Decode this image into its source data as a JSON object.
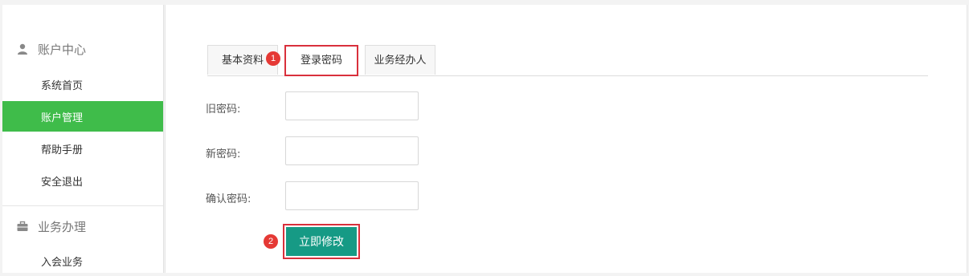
{
  "sidebar": {
    "section1": {
      "icon": "user-icon",
      "title": "账户中心"
    },
    "items1": [
      {
        "label": "系统首页"
      },
      {
        "label": "账户管理",
        "active": true
      },
      {
        "label": "帮助手册"
      },
      {
        "label": "安全退出"
      }
    ],
    "section2": {
      "icon": "briefcase-icon",
      "title": "业务办理"
    },
    "items2": [
      {
        "label": "入会业务"
      }
    ]
  },
  "tabs": [
    {
      "label": "基本资料"
    },
    {
      "label": "登录密码",
      "active": true
    },
    {
      "label": "业务经办人"
    }
  ],
  "badges": {
    "one": "1",
    "two": "2"
  },
  "form": {
    "old_password_label": "旧密码:",
    "new_password_label": "新密码:",
    "confirm_password_label": "确认密码:",
    "old_password_value": "",
    "new_password_value": "",
    "confirm_password_value": "",
    "submit_label": "立即修改"
  },
  "colors": {
    "active_sidebar": "#3fbc4a",
    "submit_button": "#169a85",
    "highlight_border": "#d9303c",
    "badge": "#e53935"
  }
}
